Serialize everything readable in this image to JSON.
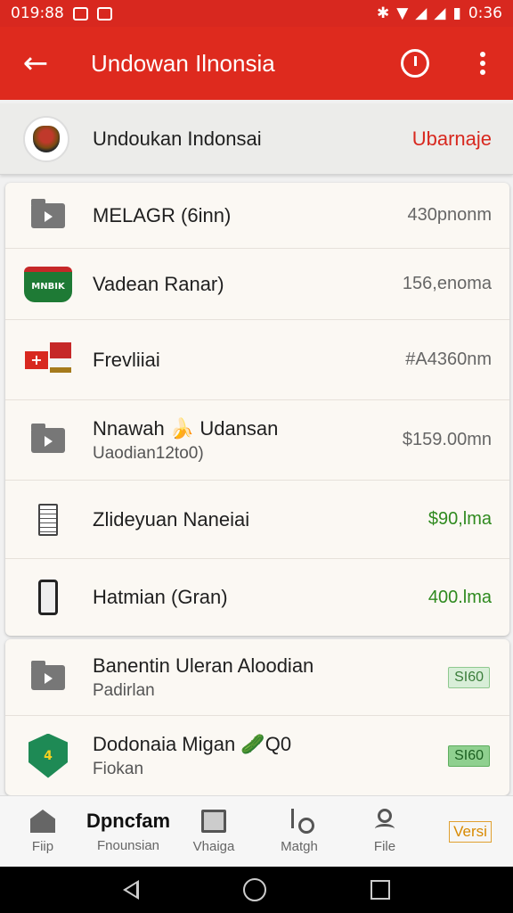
{
  "status": {
    "time_left": "019:88",
    "time_right": "0:36"
  },
  "app_bar": {
    "title": "Undowan Ilnonsia"
  },
  "header": {
    "title": "Undoukan Indonsai",
    "action": "Ubarnaje"
  },
  "rows": [
    {
      "title": "MELAGR (6inn)",
      "subtitle": "",
      "value": "430pnonm",
      "icon": "folder-icon",
      "value_color": "gray"
    },
    {
      "title": "Vadean Ranar)",
      "subtitle": "",
      "value": "156,enoma",
      "icon": "green-badge-icon",
      "value_color": "gray"
    },
    {
      "title": "Frevliiai",
      "subtitle": "",
      "value": "#A4360nm",
      "icon": "flag-icon",
      "value_color": "gray"
    },
    {
      "title": "Nnawah 🍌 Udansan",
      "subtitle": "Uaodian12to0)",
      "value": "$159.00mn",
      "icon": "folder-icon",
      "value_color": "gray"
    },
    {
      "title": "Zlideyuan Naneiai",
      "subtitle": "",
      "value": "$90,lma",
      "icon": "document-icon",
      "value_color": "green"
    },
    {
      "title": "Hatmian (Gran)",
      "subtitle": "",
      "value": "400.lma",
      "icon": "phone-icon",
      "value_color": "green"
    }
  ],
  "rows2": [
    {
      "title": "Banentin Uleran Aloodian",
      "subtitle": "Padirlan",
      "pill": "SI60",
      "icon": "folder-icon"
    },
    {
      "title": "Dodonaia Migan 🥒Q0",
      "subtitle": "Fiokan",
      "pill": "SI60",
      "icon": "shield-icon"
    }
  ],
  "nav": {
    "items": [
      {
        "label": "Fiip",
        "icon": "home-icon"
      },
      {
        "label": "Dpncfam",
        "sublabel": "Fnounsian",
        "icon": "none"
      },
      {
        "label": "Vhaiga",
        "icon": "tv-icon"
      },
      {
        "label": "Matgh",
        "icon": "music-icon"
      },
      {
        "label": "File",
        "icon": "user-icon"
      }
    ],
    "versi": "Versi"
  },
  "colors": {
    "primary": "#de2a1e",
    "accent_green": "#2f8a1f",
    "versi": "#d88a00"
  }
}
